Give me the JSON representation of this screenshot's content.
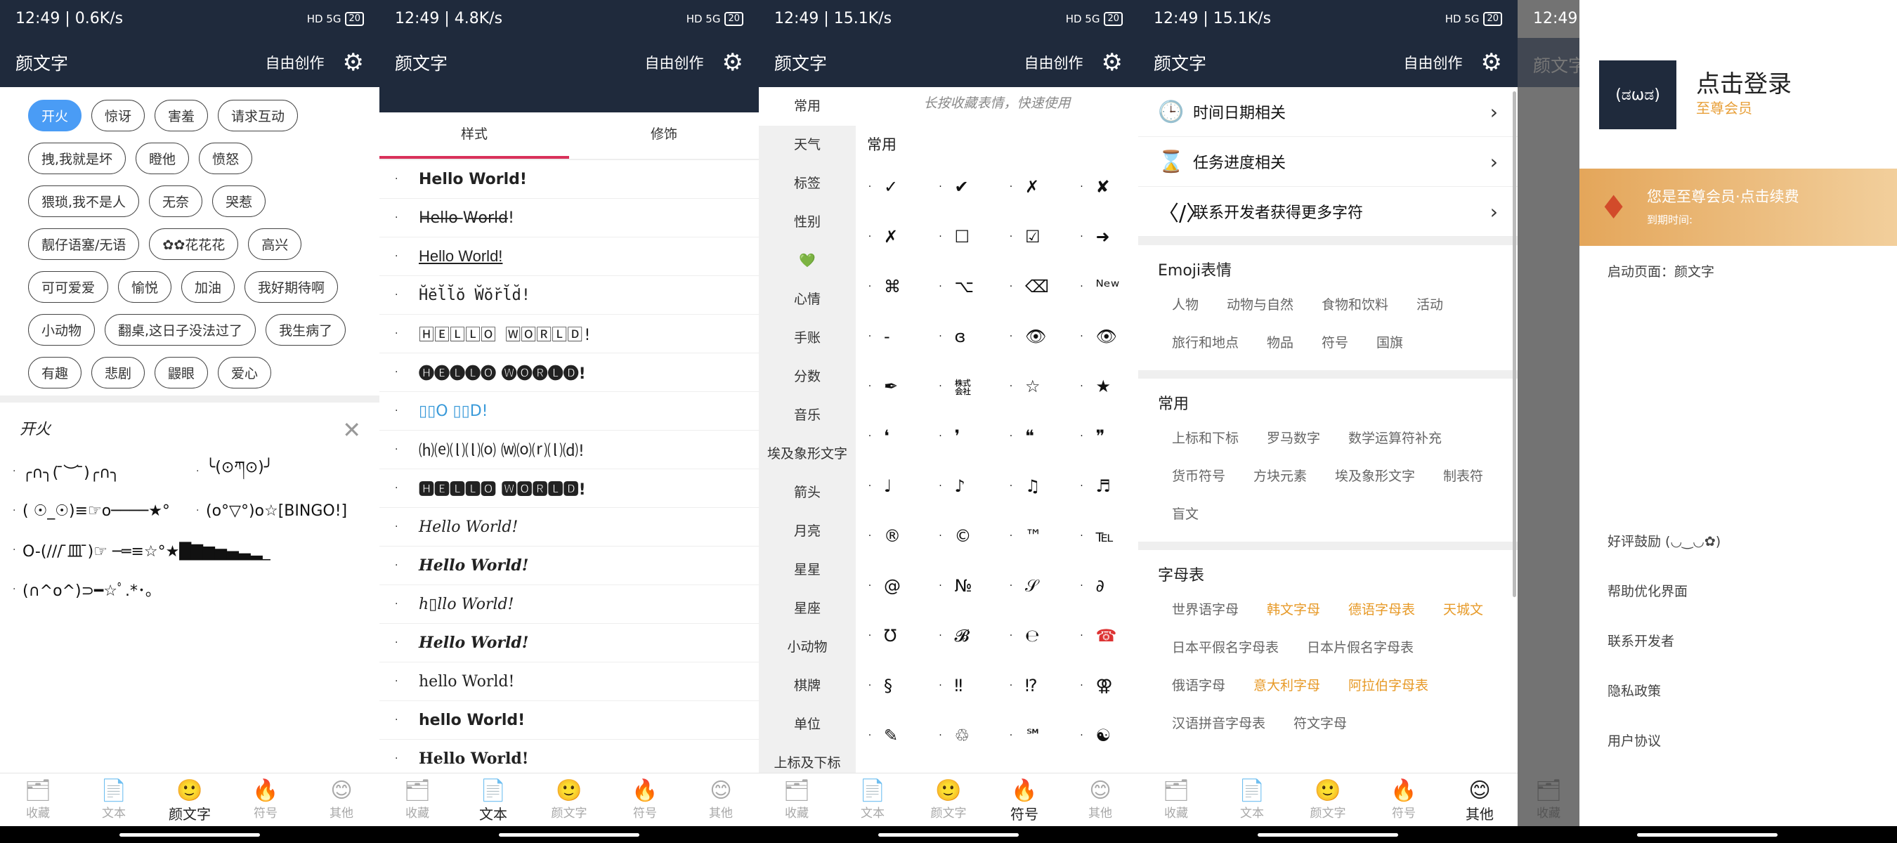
{
  "status": {
    "p1": "12:49 | 0.6K/s",
    "p2": "12:49 | 4.8K/s",
    "p3": "12:49 | 15.1K/s",
    "p4": "12:49 | 15.1K/s",
    "p5": "12:49",
    "sig": "HD 5G",
    "batt": "20"
  },
  "app": {
    "title": "颜文字",
    "action": "自由创作",
    "gear": "⚙"
  },
  "nav": [
    {
      "label": "收藏",
      "icon": "🗂"
    },
    {
      "label": "文本",
      "icon": "📄"
    },
    {
      "label": "颜文字",
      "icon": "🙂"
    },
    {
      "label": "符号",
      "icon": "🔥"
    },
    {
      "label": "其他",
      "icon": "😊"
    }
  ],
  "p1": {
    "chips": [
      "开火",
      "惊讶",
      "害羞",
      "请求互动",
      "拽,我就是坏",
      "瞪他",
      "愤怒",
      "猥琐,我不是人",
      "无奈",
      "哭惹",
      "靓仔语塞/无语",
      "✿✿花花花",
      "高兴",
      "可可爱爱",
      "愉悦",
      "加油",
      "我好期待啊",
      "小动物",
      "翻桌,这日子没法过了",
      "我生病了",
      "有趣",
      "悲剧",
      "鼹眼",
      "爱心"
    ],
    "section": "开火",
    "close": "✕",
    "emotes": [
      "╭∩╮( ̄︶ ̄)╭∩╮",
      "╰(⊙ཀ⊙)╯",
      "( ☉_☉)≡☞o────★°",
      "(o°▽°)o☆[BINGO!]",
      "O-(/// ̄皿 ̄)☞ ─═≡☆°★█▇▆▅▄▃▂_",
      "(∩^o^)⊃━☆ﾟ.*･｡"
    ]
  },
  "p2": {
    "tabs": [
      "样式",
      "修饰"
    ],
    "rows": [
      "Hello World!",
      "H̶e̶l̶l̶o̶ ̶W̶o̶r̶l̶d̶!",
      "Hello World!",
      "H̆ĕl̆l̆ŏ W̆ŏr̆l̆d̆!",
      "🄷🄴🄻🄻🄾 🅆🄾🅁🄻🄳!",
      "🅗🅔🅛🅛🅞 🅦🅞🅡🅛🅓!",
      "▯▯O ▯▯D!",
      "⒣⒠⒧⒧⒪ ⒲⒪⒭⒧⒟!",
      "🅷🅴🅻🅻🅾 🆆🅾🆁🅻🅳!",
      "Hello World!",
      "Hello World!",
      "h▯llo World!",
      "Hello World!",
      "hello World!",
      "hello World!",
      "Hello World!"
    ]
  },
  "p3": {
    "side": [
      "常用",
      "天气",
      "标签",
      "性别",
      "💚",
      "心情",
      "手账",
      "分数",
      "音乐",
      "埃及象形文字",
      "箭头",
      "月亮",
      "星星",
      "星座",
      "小动物",
      "棋牌",
      "单位",
      "上标及下标"
    ],
    "hint": "长按收藏表情，快速使用",
    "title": "常用",
    "symbols": [
      "✓",
      "✔",
      "✗",
      "✘",
      "✗",
      "☐",
      "☑",
      "➜",
      "⌘",
      "⌥",
      "⌫",
      "ᴺᵉʷ",
      "-",
      "ɞ",
      "👁",
      "👁",
      "✒",
      "㍿",
      "☆",
      "★",
      "❛",
      "❜",
      "❝",
      "❞",
      "♩",
      "♪",
      "♫",
      "♬",
      "®",
      "©",
      "™",
      "℡",
      "@",
      "№",
      "𝒮",
      "∂",
      "Ʊ",
      "𝓑",
      "℮",
      "☎",
      "§",
      "‼",
      "⁉",
      "⚢",
      "✎",
      "♲",
      "℠",
      "☯"
    ]
  },
  "p4": {
    "links": [
      {
        "icon": "🕒",
        "label": "时间日期相关"
      },
      {
        "icon": "⌛",
        "label": "任务进度相关"
      },
      {
        "icon": "〈/〉",
        "label": "联系开发者获得更多字符"
      }
    ],
    "groups": [
      {
        "title": "Emoji表情",
        "tags": [
          {
            "t": "人物"
          },
          {
            "t": "动物与自然"
          },
          {
            "t": "食物和饮料"
          },
          {
            "t": "活动"
          },
          {
            "t": "旅行和地点"
          },
          {
            "t": "物品"
          },
          {
            "t": "符号"
          },
          {
            "t": "国旗"
          }
        ]
      },
      {
        "title": "常用",
        "tags": [
          {
            "t": "上标和下标"
          },
          {
            "t": "罗马数字"
          },
          {
            "t": "数学运算符补充"
          },
          {
            "t": "货币符号"
          },
          {
            "t": "方块元素"
          },
          {
            "t": "埃及象形文字"
          },
          {
            "t": "制表符"
          },
          {
            "t": "盲文"
          }
        ]
      },
      {
        "title": "字母表",
        "tags": [
          {
            "t": "世界语字母"
          },
          {
            "t": "韩文字母",
            "o": 1
          },
          {
            "t": "德语字母表",
            "o": 1
          },
          {
            "t": "天城文",
            "o": 1
          },
          {
            "t": "日本平假名字母表"
          },
          {
            "t": "日本片假名字母表"
          },
          {
            "t": "俄语字母"
          },
          {
            "t": "意大利字母",
            "o": 1
          },
          {
            "t": "阿拉伯字母表",
            "o": 1
          },
          {
            "t": "汉语拼音字母表"
          },
          {
            "t": "符文字母"
          }
        ]
      }
    ],
    "chev": "›"
  },
  "p5": {
    "logo": "(ಡωಡ)",
    "login": "点击登录",
    "member": "至尊会员",
    "vip_title": "您是至尊会员·点击续费",
    "vip_date": "到期时间:",
    "start": "启动页面：颜文字",
    "menu": [
      "好评鼓励 (◡‿◡✿)",
      "帮助优化界面",
      "联系开发者",
      "隐私政策",
      "用户协议"
    ],
    "nav_label": "收藏"
  }
}
